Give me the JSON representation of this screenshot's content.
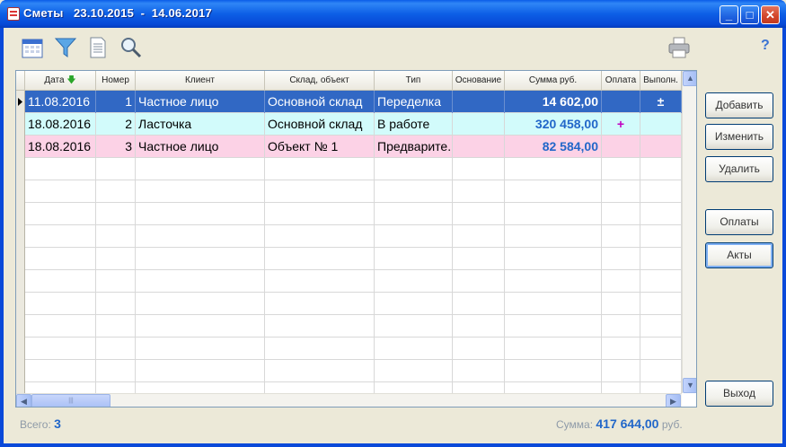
{
  "window": {
    "title": "Сметы   23.10.2015  -  14.06.2017",
    "minimize": "_",
    "maximize": "□",
    "close": "✕"
  },
  "toolbar": {
    "icons": [
      "calendar-icon",
      "filter-icon",
      "document-icon",
      "search-icon",
      "printer-icon"
    ],
    "help": "?"
  },
  "table": {
    "columns": [
      "Дата",
      "Номер",
      "Клиент",
      "Склад, объект",
      "Тип",
      "Основание",
      "Сумма руб.",
      "Оплата",
      "Выполн."
    ],
    "sort_indicator": "🡇",
    "rows": [
      {
        "date": "11.08.2016",
        "number": "1",
        "client": "Частное лицо",
        "warehouse": "Основной склад",
        "type": "Переделка",
        "basis": "",
        "sum": "14 602,00",
        "payment": "",
        "done": "±",
        "color": "#3168c4"
      },
      {
        "date": "18.08.2016",
        "number": "2",
        "client": "Ласточка",
        "warehouse": "Основной склад",
        "type": "В работе",
        "basis": "",
        "sum": "320 458,00",
        "payment": "+",
        "done": "",
        "color": "#d2fbfb"
      },
      {
        "date": "18.08.2016",
        "number": "3",
        "client": "Частное лицо",
        "warehouse": "Объект № 1",
        "type": "Предварите.",
        "basis": "",
        "sum": "82 584,00",
        "payment": "",
        "done": "",
        "color": "#fcd2e6"
      }
    ],
    "scroll_up": "▲",
    "scroll_down": "▼",
    "scroll_left": "◀",
    "scroll_right": "▶",
    "thumb_grip": "|||"
  },
  "buttons": {
    "add": "Добавить",
    "edit": "Изменить",
    "delete": "Удалить",
    "payments": "Оплаты",
    "acts": "Акты",
    "exit": "Выход"
  },
  "status": {
    "total_label": "Всего:",
    "total_value": "3",
    "sum_label": "Сумма:",
    "sum_value": "417 644,00",
    "currency": "руб."
  }
}
